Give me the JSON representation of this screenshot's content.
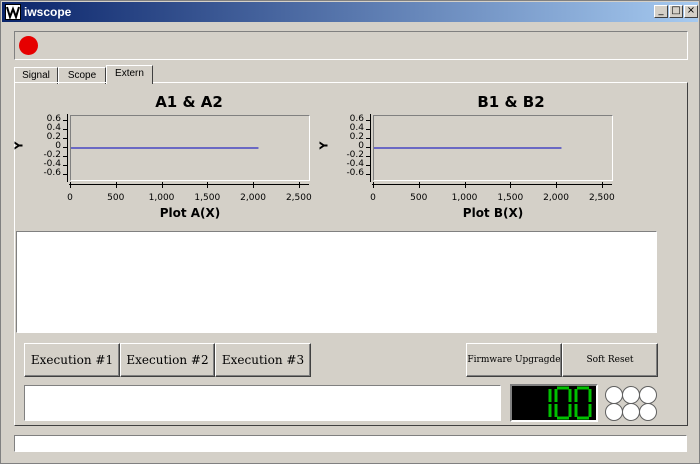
{
  "window": {
    "title": "iwscope",
    "minimize": "_",
    "maximize": "□",
    "close": "×"
  },
  "tabs": [
    {
      "label": "Signal",
      "active": false
    },
    {
      "label": "Scope",
      "active": false
    },
    {
      "label": "Extern",
      "active": true
    }
  ],
  "plots": [
    {
      "title": "A1 & A2",
      "xlabel": "Plot A(X)",
      "ylabel": "Y",
      "y_ticks": [
        "0.6",
        "0.4",
        "0.2",
        "0",
        "-0.2",
        "-0.4",
        "-0.6"
      ],
      "x_ticks": [
        "0",
        "500",
        "1,000",
        "1,500",
        "2,000",
        "2,500"
      ]
    },
    {
      "title": "B1 & B2",
      "xlabel": "Plot B(X)",
      "ylabel": "Y",
      "y_ticks": [
        "0.6",
        "0.4",
        "0.2",
        "0",
        "-0.2",
        "-0.4",
        "-0.6"
      ],
      "x_ticks": [
        "0",
        "500",
        "1,000",
        "1,500",
        "2,000",
        "2,500"
      ]
    }
  ],
  "chart_data": [
    {
      "type": "line",
      "title": "A1 & A2",
      "xlabel": "Plot A(X)",
      "ylabel": "Y",
      "xlim": [
        0,
        2600
      ],
      "ylim": [
        -0.7,
        0.7
      ],
      "series": [
        {
          "x": [
            0,
            2048
          ],
          "y": [
            0,
            0
          ]
        }
      ],
      "color": "#0000c0"
    },
    {
      "type": "line",
      "title": "B1 & B2",
      "xlabel": "Plot B(X)",
      "ylabel": "Y",
      "xlim": [
        0,
        2600
      ],
      "ylim": [
        -0.7,
        0.7
      ],
      "series": [
        {
          "x": [
            0,
            2048
          ],
          "y": [
            0,
            0
          ]
        }
      ],
      "color": "#0000c0"
    }
  ],
  "buttons": {
    "exec1": "Execution #1",
    "exec2": "Execution #2",
    "exec3": "Execution #3",
    "firmware": "Firmware Upgragde",
    "reset": "Soft Reset"
  },
  "display": {
    "lcd_value": "100",
    "lcd_color": "#00c000"
  },
  "colors": {
    "record": "#e60000",
    "line": "#0000c0"
  }
}
